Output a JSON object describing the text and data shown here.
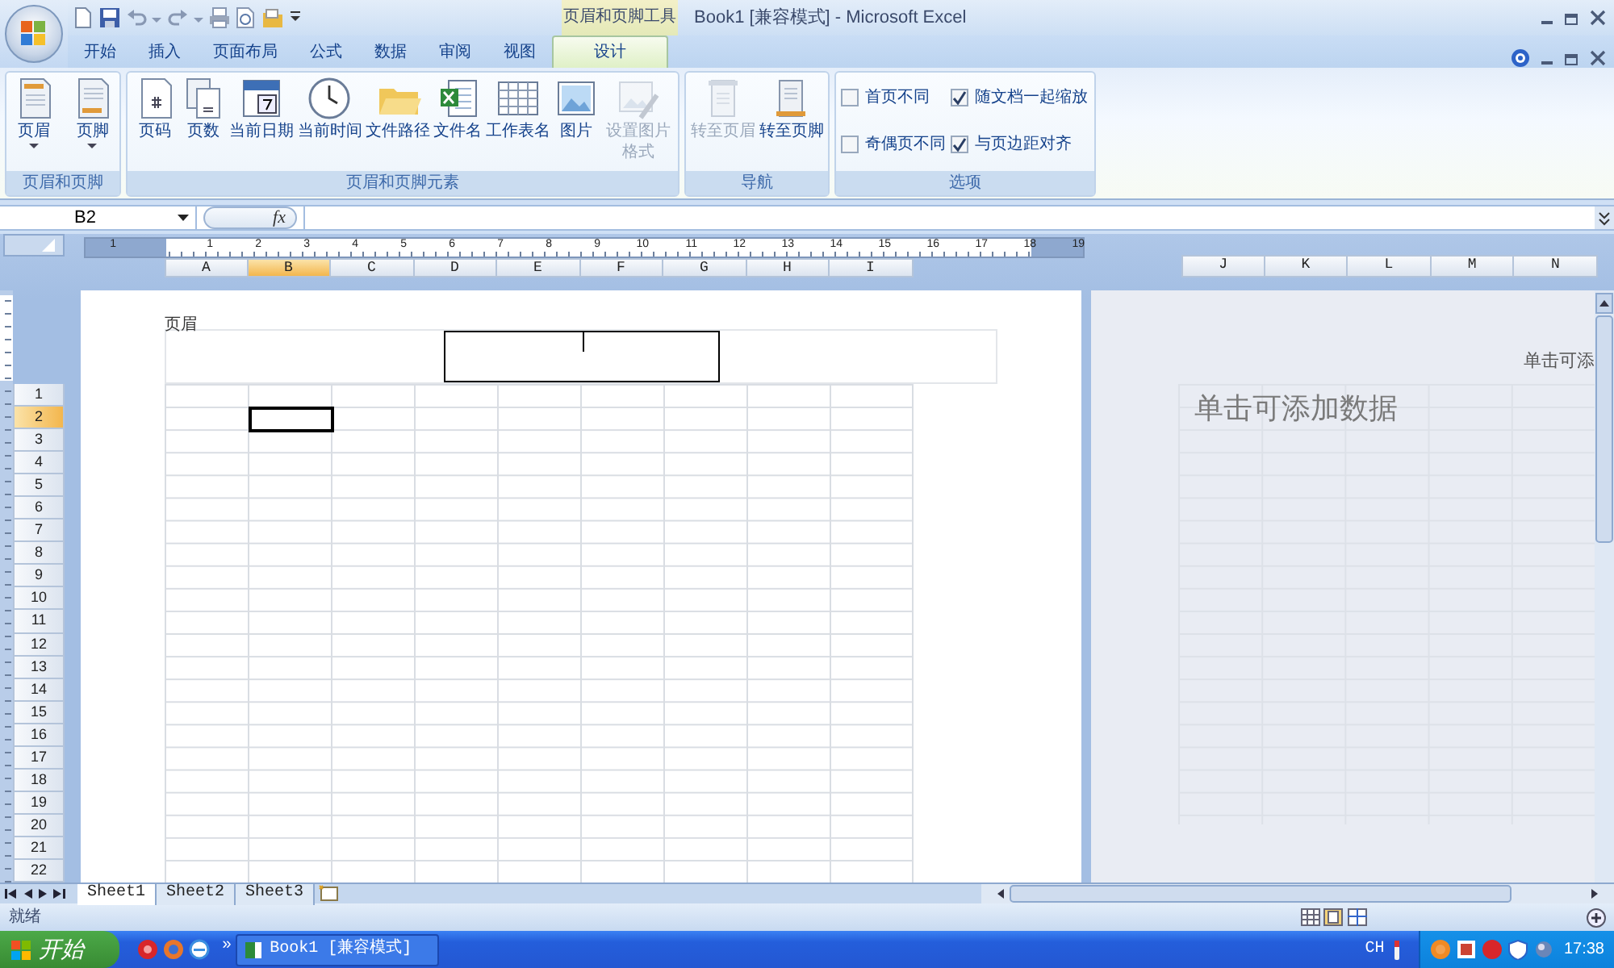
{
  "window": {
    "title": "Book1  [兼容模式] - Microsoft Excel",
    "context_tab_group": "页眉和页脚工具"
  },
  "ribbon_tabs": [
    {
      "label": "开始",
      "selected": false
    },
    {
      "label": "插入",
      "selected": false
    },
    {
      "label": "页面布局",
      "selected": false
    },
    {
      "label": "公式",
      "selected": false
    },
    {
      "label": "数据",
      "selected": false
    },
    {
      "label": "审阅",
      "selected": false
    },
    {
      "label": "视图",
      "selected": false
    },
    {
      "label": "设计",
      "selected": true
    }
  ],
  "ribbon_groups": [
    {
      "label": "页眉和页脚",
      "kind": "buttons",
      "buttons": [
        {
          "label": "页眉",
          "dropdown": true,
          "disabled": false
        },
        {
          "label": "页脚",
          "dropdown": true,
          "disabled": false
        }
      ]
    },
    {
      "label": "页眉和页脚元素",
      "kind": "buttons",
      "buttons": [
        {
          "label": "页码",
          "dropdown": false,
          "disabled": false
        },
        {
          "label": "页数",
          "dropdown": false,
          "disabled": false
        },
        {
          "label": "当前日期",
          "dropdown": false,
          "disabled": false
        },
        {
          "label": "当前时间",
          "dropdown": false,
          "disabled": false
        },
        {
          "label": "文件路径",
          "dropdown": false,
          "disabled": false
        },
        {
          "label": "文件名",
          "dropdown": false,
          "disabled": false
        },
        {
          "label": "工作表名",
          "dropdown": false,
          "disabled": false
        },
        {
          "label": "图片",
          "dropdown": false,
          "disabled": false
        },
        {
          "label": "设置图片格式",
          "dropdown": false,
          "disabled": true
        }
      ]
    },
    {
      "label": "导航",
      "kind": "buttons",
      "buttons": [
        {
          "label": "转至页眉",
          "dropdown": false,
          "disabled": true
        },
        {
          "label": "转至页脚",
          "dropdown": false,
          "disabled": false
        }
      ]
    },
    {
      "label": "选项",
      "kind": "checkboxes",
      "items": [
        {
          "label": "首页不同",
          "checked": false
        },
        {
          "label": "随文档一起缩放",
          "checked": true
        },
        {
          "label": "奇偶页不同",
          "checked": false
        },
        {
          "label": "与页边距对齐",
          "checked": true
        }
      ]
    }
  ],
  "formula_bar": {
    "name_box": "B2",
    "function_button": "fx"
  },
  "ruler": [
    "1",
    "1",
    "2",
    "3",
    "4",
    "5",
    "6",
    "7",
    "8",
    "9",
    "10",
    "11",
    "12",
    "13",
    "14",
    "15",
    "16",
    "17",
    "18",
    "19"
  ],
  "columns": [
    {
      "label": "A",
      "selected": false
    },
    {
      "label": "B",
      "selected": true
    },
    {
      "label": "C",
      "selected": false
    },
    {
      "label": "D",
      "selected": false
    },
    {
      "label": "E",
      "selected": false
    },
    {
      "label": "F",
      "selected": false
    },
    {
      "label": "G",
      "selected": false
    },
    {
      "label": "H",
      "selected": false
    },
    {
      "label": "I",
      "selected": false
    }
  ],
  "rows": [
    {
      "label": "1",
      "selected": false
    },
    {
      "label": "2",
      "selected": true
    },
    {
      "label": "3",
      "selected": false
    },
    {
      "label": "4",
      "selected": false
    },
    {
      "label": "5",
      "selected": false
    },
    {
      "label": "6",
      "selected": false
    },
    {
      "label": "7",
      "selected": false
    },
    {
      "label": "8",
      "selected": false
    },
    {
      "label": "9",
      "selected": false
    },
    {
      "label": "10",
      "selected": false
    },
    {
      "label": "11",
      "selected": false
    },
    {
      "label": "12",
      "selected": false
    },
    {
      "label": "13",
      "selected": false
    },
    {
      "label": "14",
      "selected": false
    },
    {
      "label": "15",
      "selected": false
    },
    {
      "label": "16",
      "selected": false
    },
    {
      "label": "17",
      "selected": false
    },
    {
      "label": "18",
      "selected": false
    },
    {
      "label": "19",
      "selected": false
    },
    {
      "label": "20",
      "selected": false
    },
    {
      "label": "21",
      "selected": false
    },
    {
      "label": "22",
      "selected": false
    }
  ],
  "page": {
    "header_label": "页眉"
  },
  "next_page": {
    "columns": [
      "J",
      "K",
      "L",
      "M",
      "N"
    ],
    "header_hint": "单击可添",
    "data_hint": "单击可添加数据"
  },
  "sheet_tabs": [
    {
      "label": "Sheet1",
      "selected": true
    },
    {
      "label": "Sheet2",
      "selected": false
    },
    {
      "label": "Sheet3",
      "selected": false
    }
  ],
  "status_bar": {
    "text": "就绪"
  },
  "taskbar": {
    "start": "开始",
    "more": "»",
    "window": "Book1  [兼容模式]",
    "language": "CH",
    "clock": "17:38"
  }
}
